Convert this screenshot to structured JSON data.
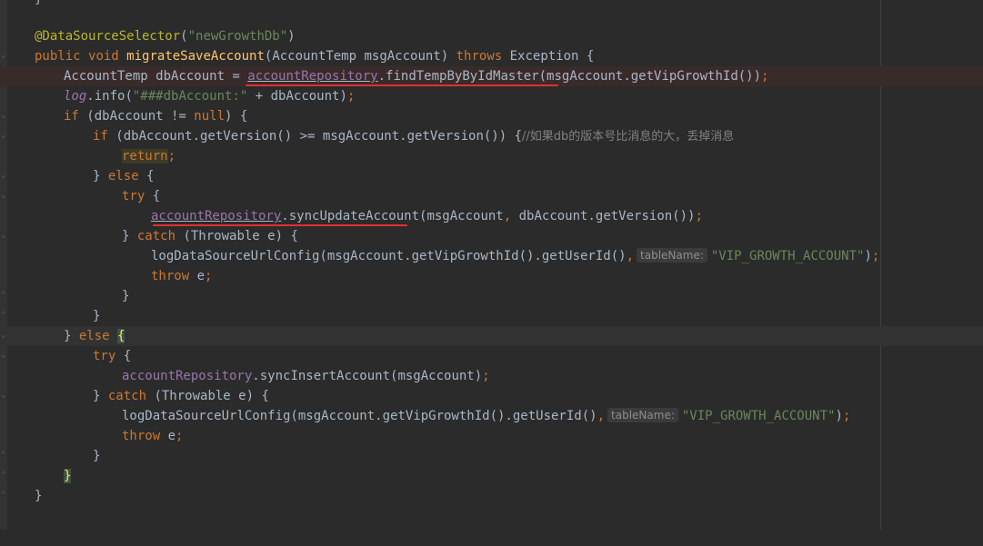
{
  "editor": {
    "language": "java",
    "lines": [
      {
        "top_brace": "}"
      },
      {
        "annotation": "@DataSourceSelector",
        "paren_open": "(",
        "value": "\"newGrowthDb\"",
        "paren_close": ")"
      },
      {
        "k1": "public",
        "k2": "void",
        "name": "migrateSaveAccount",
        "params": "(AccountTemp msgAccount) ",
        "k3": "throws",
        "rest": " Exception {"
      },
      {
        "pre": "AccountTemp dbAccount = ",
        "field": "accountRepository",
        "dot": ".",
        "call": "findTempByByIdMaster(msgAccount.getVipGrowthId())",
        "semi": ";"
      },
      {
        "field": "log",
        "call": ".info(",
        "str": "\"###dbAccount:\"",
        "rest": " + dbAccount)",
        "semi": ";"
      },
      {
        "k1": "if",
        "pre": " (dbAccount != ",
        "k2": "null",
        "rest": ") {"
      },
      {
        "k1": "if",
        "pre": " (dbAccount.getVersion() >= msgAccount.getVersion()) {",
        "comment": "//如果db的版本号比消息的大，丢掉消息"
      },
      {
        "k1": "return",
        "semi": ";"
      },
      {
        "pre": "} ",
        "k1": "else",
        "rest": " {"
      },
      {
        "k1": "try",
        "rest": " {"
      },
      {
        "field": "accountRepository",
        "call": ".syncUpdateAccount(msgAccount",
        "comma": ",",
        "rest": " dbAccount.getVersion())",
        "semi": ";"
      },
      {
        "pre": "} ",
        "k1": "catch",
        "rest": " (Throwable e) {"
      },
      {
        "pre": "logDataSourceUrlConfig(msgAccount.getVipGrowthId().getUserId()",
        "comma": ",",
        "hint": "tableName:",
        "str": "\"VIP_GROWTH_ACCOUNT\"",
        "rest": ")",
        "semi": ";"
      },
      {
        "k1": "throw",
        "rest": " e",
        "semi": ";"
      },
      {
        "pre": "}"
      },
      {
        "pre": "}"
      },
      {
        "pre": "} ",
        "k1": "else",
        "brace": "{"
      },
      {
        "k1": "try",
        "rest": " {"
      },
      {
        "field": "accountRepository",
        "call": ".syncInsertAccount(msgAccount)",
        "semi": ";"
      },
      {
        "pre": "} ",
        "k1": "catch",
        "rest": " (Throwable e) {"
      },
      {
        "pre": "logDataSourceUrlConfig(msgAccount.getVipGrowthId().getUserId()",
        "comma": ",",
        "hint": "tableName:",
        "str": "\"VIP_GROWTH_ACCOUNT\"",
        "rest": ")",
        "semi": ";"
      },
      {
        "k1": "throw",
        "rest": " e",
        "semi": ";"
      },
      {
        "pre": "}"
      },
      {
        "brace": "}"
      },
      {
        "pre": "}"
      }
    ]
  },
  "colors": {
    "background": "#2b2b2b",
    "keyword": "#cc7832",
    "string": "#6a8759",
    "method_decl": "#ffc66d",
    "field": "#9876aa",
    "annotation": "#bbb529",
    "comment": "#808080",
    "red_underline": "#e03030"
  }
}
